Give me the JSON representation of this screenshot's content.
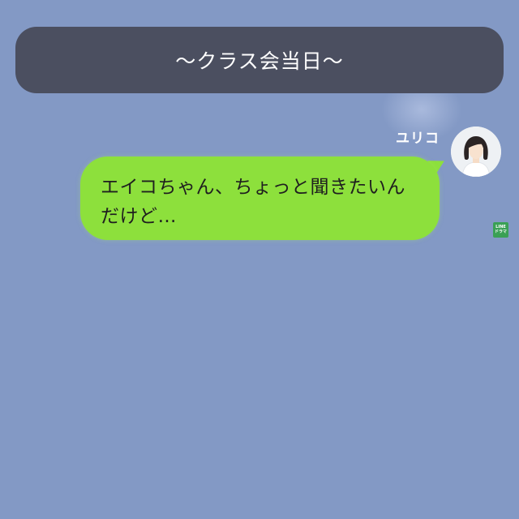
{
  "banner": {
    "text": "〜クラス会当日〜"
  },
  "message": {
    "sender": "ユリコ",
    "text": "エイコちゃん、ちょっと聞きたいんだけど…",
    "avatar_icon": "woman-avatar-icon"
  },
  "watermark": {
    "line1": "LINE",
    "line2": "ドラマ"
  },
  "colors": {
    "background": "#8399c5",
    "banner": "#4b4f60",
    "bubble": "#8de03c",
    "logo": "#3aa055"
  }
}
